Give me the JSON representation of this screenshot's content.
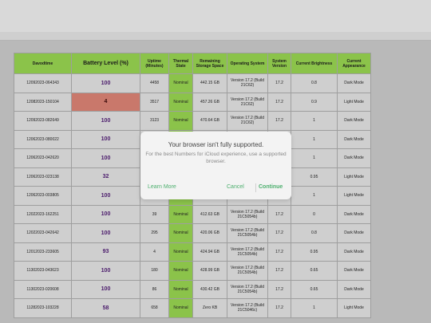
{
  "table": {
    "headers": [
      "Davodtime",
      "Battery Level (%)",
      "Uptime (Minutes)",
      "Thermal State",
      "Remaining Storage Space",
      "Operating System",
      "System Version",
      "Current Brightness",
      "Current Appearance"
    ],
    "rows": [
      [
        "12092023-064343",
        "100",
        "4458",
        "Nominal",
        "442.15 GB",
        "Version 17.2 (Build 21C62)",
        "17.2",
        "0.8",
        "Dark Mode"
      ],
      [
        "12082023-150104",
        "4",
        "3517",
        "Nominal",
        "457.26 GB",
        "Version 17.2 (Build 21C62)",
        "17.2",
        "0.9",
        "Light Mode"
      ],
      [
        "12092023-082649",
        "100",
        "3123",
        "Nominal",
        "470.64 GB",
        "Version 17.2 (Build 21C62)",
        "17.2",
        "1",
        "Dark Mode"
      ],
      [
        "12062023-080022",
        "100",
        "",
        "",
        "",
        "",
        "",
        "1",
        "Dark Mode"
      ],
      [
        "12062023-042620",
        "100",
        "",
        "",
        "",
        "",
        "",
        "1",
        "Dark Mode"
      ],
      [
        "12062023-023138",
        "32",
        "",
        "",
        "",
        "",
        "",
        "0.95",
        "Light Mode"
      ],
      [
        "12062023-003805",
        "100",
        "",
        "",
        "",
        "",
        "",
        "1",
        "Light Mode"
      ],
      [
        "12022023-162251",
        "100",
        "39",
        "Nominal",
        "412.63 GB",
        "Version 17.2 (Build 21C5054b)",
        "17.2",
        "0",
        "Dark Mode"
      ],
      [
        "12022023-042642",
        "100",
        "295",
        "Nominal",
        "420.06 GB",
        "Version 17.2 (Build 21C5054b)",
        "17.2",
        "0.8",
        "Dark Mode"
      ],
      [
        "12012023-233605",
        "93",
        "4",
        "Nominal",
        "424.94 GB",
        "Version 17.2 (Build 21C5054b)",
        "17.2",
        "0.95",
        "Dark Mode"
      ],
      [
        "11302023-043623",
        "100",
        "180",
        "Nominal",
        "428.99 GB",
        "Version 17.2 (Build 21C5054b)",
        "17.2",
        "0.65",
        "Dark Mode"
      ],
      [
        "11302023-020608",
        "100",
        "86",
        "Nominal",
        "430.42 GB",
        "Version 17.2 (Build 21C5054b)",
        "17.2",
        "0.65",
        "Dark Mode"
      ],
      [
        "11282023-103228",
        "58",
        "658",
        "Nominal",
        "Zero KB",
        "Version 17.2 (Build 21C5046c)",
        "17.2",
        "1",
        "Light Mode"
      ]
    ],
    "low_battery_row": 1
  },
  "dialog": {
    "title": "Your browser isn't fully supported.",
    "body": "For the best Numbers for iCloud experience, use a supported browser.",
    "learn_more": "Learn More",
    "cancel": "Cancel",
    "continue": "Continue"
  },
  "colors": {
    "header_green": "#8bc34a",
    "low_battery": "#c9786b",
    "accent": "#4caf6d"
  }
}
